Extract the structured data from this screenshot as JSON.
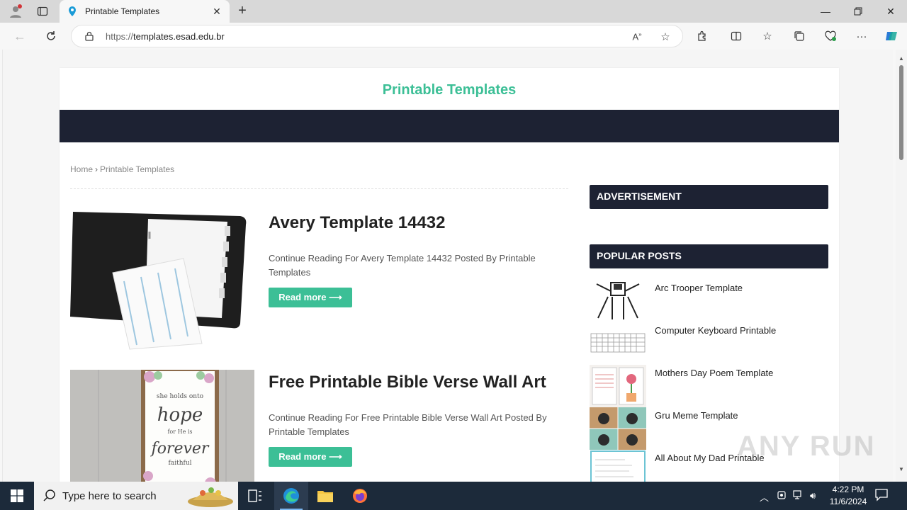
{
  "browser": {
    "tab_title": "Printable Templates",
    "url_prefix": "https://",
    "url_domain": "templates.esad.edu.br"
  },
  "site": {
    "title": "Printable Templates",
    "breadcrumb": {
      "home": "Home",
      "separator": "›",
      "current": "Printable Templates"
    },
    "posts": [
      {
        "title": "Avery Template 14432",
        "excerpt": "Continue Reading For Avery Template 14432 Posted By Printable Templates",
        "read_more": "Read more ⟶"
      },
      {
        "title": "Free Printable Bible Verse Wall Art",
        "excerpt": "Continue Reading For Free Printable Bible Verse Wall Art Posted By Printable Templates",
        "read_more": "Read more ⟶"
      }
    ],
    "sidebar": {
      "advertisement_heading": "ADVERTISEMENT",
      "popular_heading": "POPULAR POSTS",
      "popular_posts": [
        "Arc Trooper Template",
        "Computer Keyboard Printable",
        "Mothers Day Poem Template",
        "Gru Meme Template",
        "All About My Dad Printable"
      ]
    },
    "watermark": "ANY RUN"
  },
  "taskbar": {
    "search_placeholder": "Type here to search",
    "time": "4:22 PM",
    "date": "11/6/2024"
  },
  "colors": {
    "accent": "#3cbf96",
    "nav_dark": "#1d2233",
    "taskbar": "#1c2a3a"
  }
}
